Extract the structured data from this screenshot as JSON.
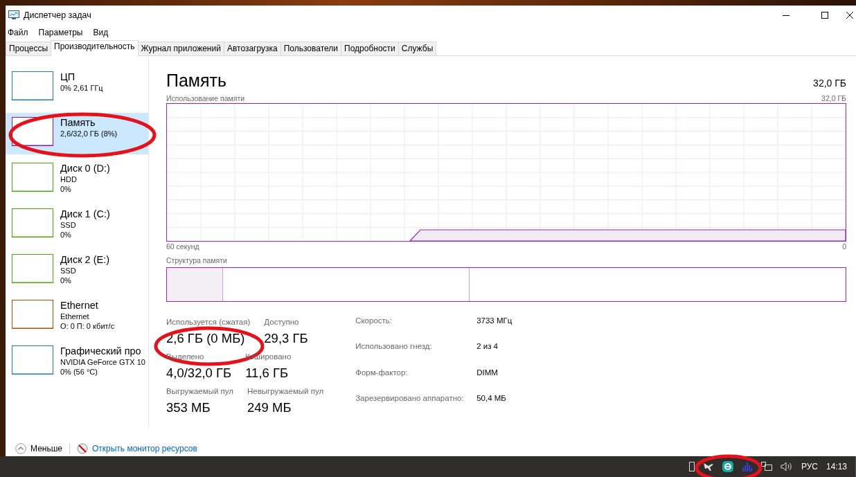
{
  "window": {
    "title": "Диспетчер задач"
  },
  "menu": [
    "Файл",
    "Параметры",
    "Вид"
  ],
  "tabs": [
    {
      "label": "Процессы",
      "selected": false
    },
    {
      "label": "Производительность",
      "selected": true
    },
    {
      "label": "Журнал приложений",
      "selected": false
    },
    {
      "label": "Автозагрузка",
      "selected": false
    },
    {
      "label": "Пользователи",
      "selected": false
    },
    {
      "label": "Подробности",
      "selected": false
    },
    {
      "label": "Службы",
      "selected": false
    }
  ],
  "sidebar": {
    "items": [
      {
        "name": "ЦП",
        "lines": [
          "0% 2,61 ГГц"
        ],
        "color": "#1f7bbd",
        "selected": false,
        "circled": false
      },
      {
        "name": "Память",
        "lines": [
          "2,6/32,0 ГБ (8%)"
        ],
        "color": "#8b12ae",
        "selected": true,
        "circled": true
      },
      {
        "name": "Диск 0 (D:)",
        "lines": [
          "HDD",
          "0%"
        ],
        "color": "#4da60c",
        "selected": false,
        "circled": false
      },
      {
        "name": "Диск 1 (C:)",
        "lines": [
          "SSD",
          "0%"
        ],
        "color": "#4da60c",
        "selected": false,
        "circled": false
      },
      {
        "name": "Диск 2 (E:)",
        "lines": [
          "SSD",
          "0%"
        ],
        "color": "#4da60c",
        "selected": false,
        "circled": false
      },
      {
        "name": "Ethernet",
        "lines": [
          "Ethernet",
          "О: 0 П: 0 кбит/с"
        ],
        "color": "#a74f01",
        "selected": false,
        "circled": false
      },
      {
        "name": "Графический про",
        "lines": [
          "NVIDIA GeForce GTX 10",
          "0% (56 °C)"
        ],
        "color": "#1f7bbd",
        "selected": false,
        "circled": false
      }
    ]
  },
  "panel": {
    "title": "Память",
    "total": "32,0 ГБ",
    "usage_chart": {
      "label": "Использование памяти",
      "max_label": "32,0 ГБ",
      "start_label": "60 секунд",
      "end_label": "0"
    },
    "composition": {
      "label": "Структура памяти"
    },
    "stat_rows": [
      [
        {
          "label": "Используется (сжатая)",
          "value": "2,6 ГБ (0 МБ)",
          "circled": true
        },
        {
          "label": "Доступно",
          "value": "29,3 ГБ",
          "circled": false
        }
      ],
      [
        {
          "label": "Выделено",
          "value": "4,0/32,0 ГБ",
          "circled": false
        },
        {
          "label": "Кэшировано",
          "value": "11,6 ГБ",
          "circled": false
        }
      ],
      [
        {
          "label": "Выгружаемый пул",
          "value": "353 МБ",
          "circled": false
        },
        {
          "label": "Невыгружаемый пул",
          "value": "249 МБ",
          "circled": false
        }
      ]
    ],
    "properties": [
      {
        "label": "Скорость:",
        "value": "3733 МГц"
      },
      {
        "label": "Использовано гнезд:",
        "value": "2 из 4"
      },
      {
        "label": "Форм-фактор:",
        "value": "DIMM"
      },
      {
        "label": "Зарезервировано аппаратно:",
        "value": "50,4 МБ"
      }
    ]
  },
  "footer": {
    "less": "Меньше",
    "monitor_link": "Открыть монитор ресурсов"
  },
  "taskbar": {
    "language": "РУС",
    "time": "14:13",
    "circled": true
  }
}
